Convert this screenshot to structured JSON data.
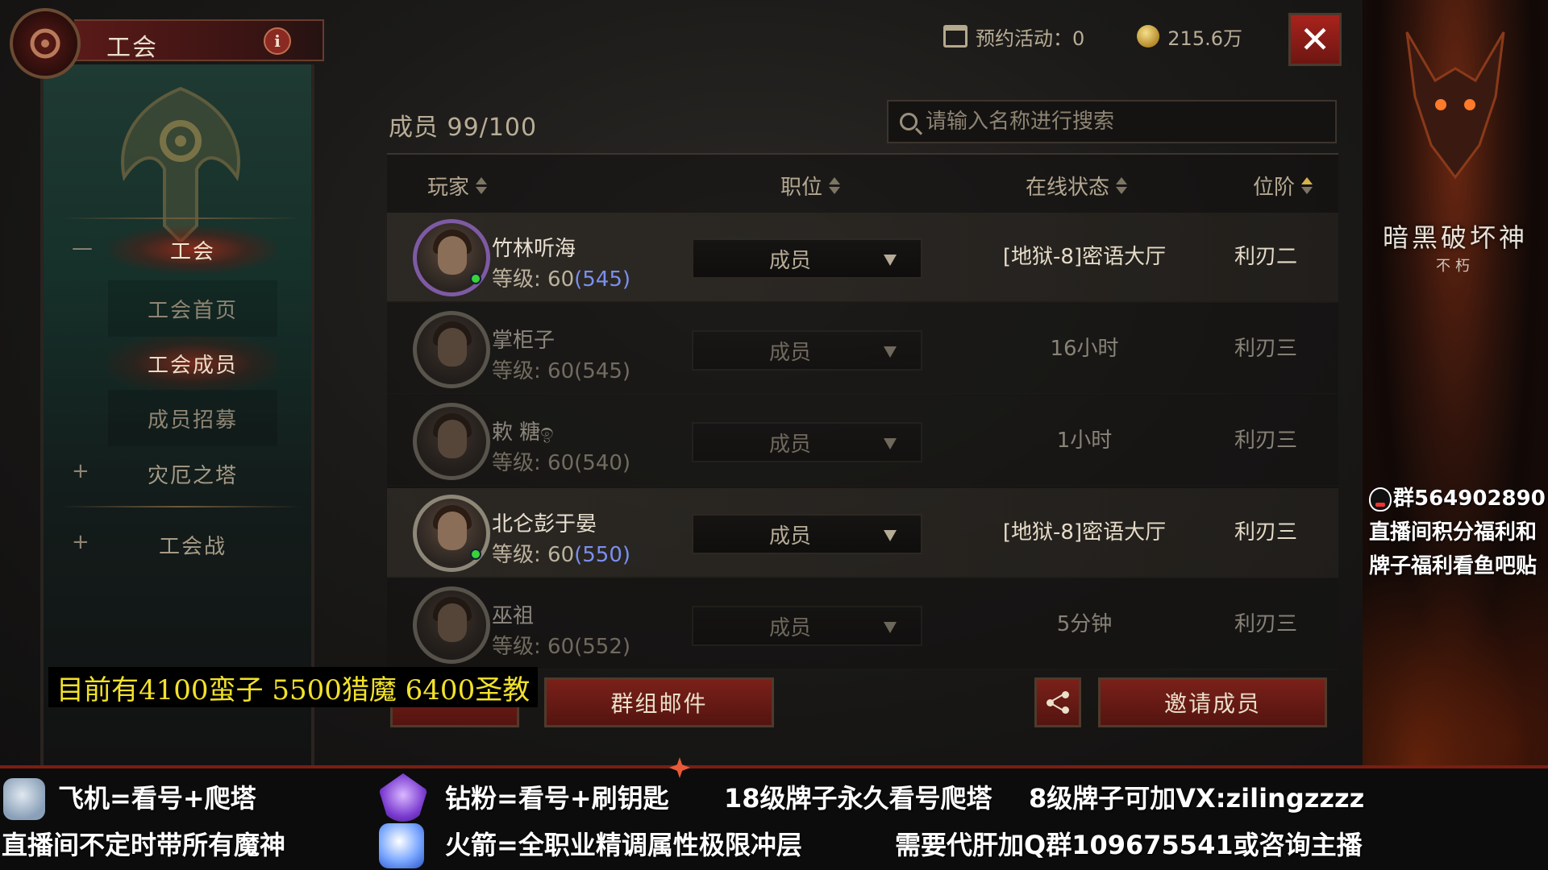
{
  "header": {
    "title": "工会",
    "info_label": "i"
  },
  "top_bar": {
    "reserved_activity": "预约活动：0",
    "gold": "215.6万"
  },
  "sidebar": {
    "section_guild": "工会",
    "section_guild_mark": "—",
    "sub_items": [
      "工会首页",
      "工会成员",
      "成员招募"
    ],
    "tower": "灾厄之塔",
    "guild_war": "工会战",
    "expand_mark": "+"
  },
  "members": {
    "count_label": "成员 99/100",
    "search_placeholder": "请输入名称进行搜索",
    "columns": {
      "player": "玩家",
      "position": "职位",
      "status": "在线状态",
      "rank": "位阶"
    },
    "rows": [
      {
        "name": "竹林听海",
        "level_prefix": "等级: 60",
        "level_power": "(545)",
        "role": "成员",
        "status": "[地狱-8]密语大厅",
        "rank": "利刃二",
        "online": true
      },
      {
        "name": "掌柜子",
        "level_prefix": "等级: 60",
        "level_power": "(545)",
        "role": "成员",
        "status": "16小时",
        "rank": "利刃三",
        "online": false
      },
      {
        "name": "欶 糖ඉ",
        "level_prefix": "等级: 60",
        "level_power": "(540)",
        "role": "成员",
        "status": "1小时",
        "rank": "利刃三",
        "online": false
      },
      {
        "name": "北仑彭于晏",
        "level_prefix": "等级: 60",
        "level_power": "(550)",
        "role": "成员",
        "status": "[地狱-8]密语大厅",
        "rank": "利刃三",
        "online": true
      },
      {
        "name": "巫祖",
        "level_prefix": "等级: 60",
        "level_power": "(552)",
        "role": "成员",
        "status": "5分钟",
        "rank": "利刃三",
        "online": false
      }
    ]
  },
  "buttons": {
    "group_mail": "群组邮件",
    "invite": "邀请成员"
  },
  "overlay": {
    "text": "目前有4100蛮子  5500猎魔  6400圣教"
  },
  "stream_panel": {
    "logo": "暗黑破坏神",
    "logo_sub": "不朽",
    "qq_group": "群564902890",
    "line2": "直播间积分福利和",
    "line3": "牌子福利看鱼吧贴"
  },
  "banner": {
    "line1_a": "飞机=看号+爬塔",
    "line1_b": "钻粉=看号+刷钥匙",
    "line1_c": "18级牌子永久看号爬塔",
    "line1_d": "8级牌子可加VX:zilingzzzz",
    "line2_a": "直播间不定时带所有魔神",
    "line2_b": "火箭=全职业精调属性极限冲层",
    "line2_c": "需要代肝加Q群109675541或咨询主播"
  },
  "colors": {
    "accent_red": "#7a2019",
    "power_blue": "#7b8ff0",
    "overlay_yellow": "#f2e22a",
    "online_green": "#3ad23a"
  }
}
